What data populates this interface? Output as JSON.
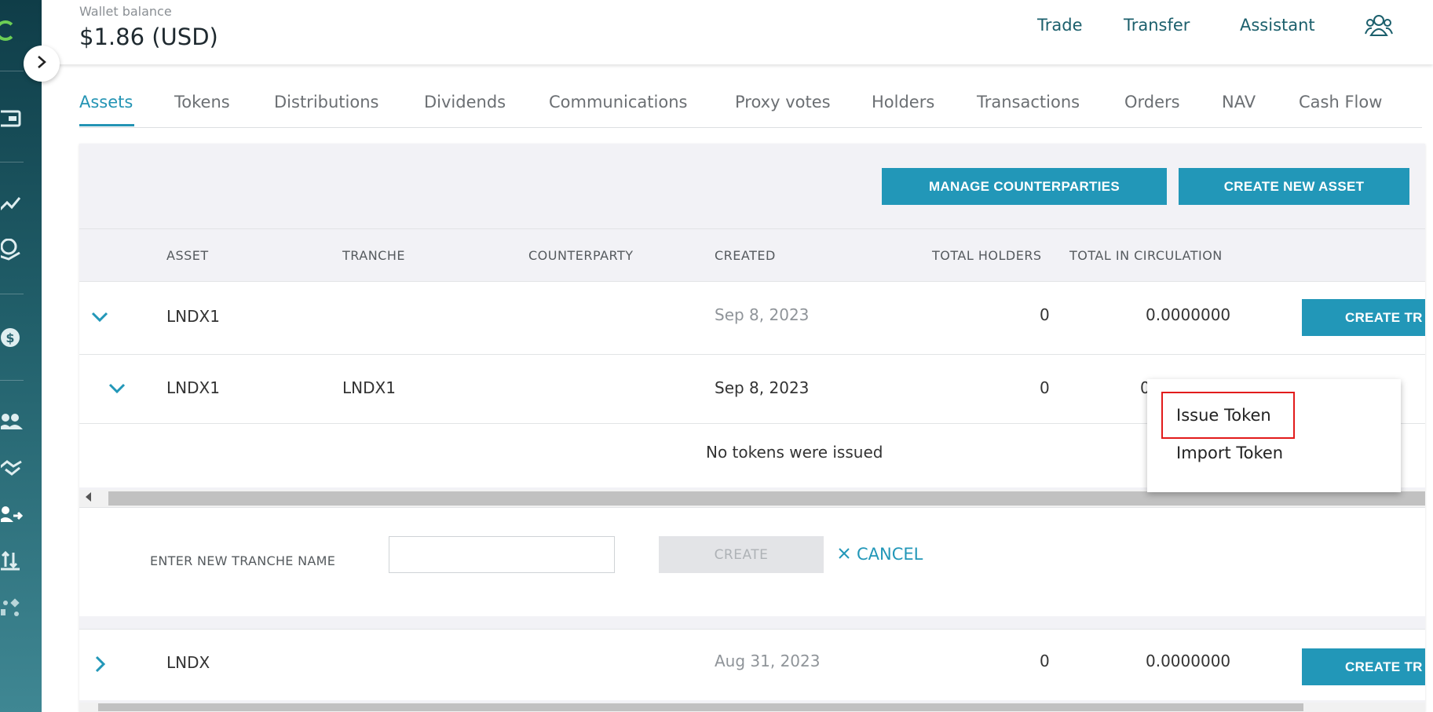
{
  "header": {
    "wallet_label": "Wallet balance",
    "wallet_value": "$1.86 (USD)",
    "nav": {
      "trade": "Trade",
      "transfer": "Transfer",
      "assistant": "Assistant"
    }
  },
  "tabs": [
    {
      "label": "Assets",
      "active": true
    },
    {
      "label": "Tokens"
    },
    {
      "label": "Distributions"
    },
    {
      "label": "Dividends"
    },
    {
      "label": "Communications"
    },
    {
      "label": "Proxy votes"
    },
    {
      "label": "Holders"
    },
    {
      "label": "Transactions"
    },
    {
      "label": "Orders"
    },
    {
      "label": "NAV"
    },
    {
      "label": "Cash Flow"
    }
  ],
  "toolbar": {
    "manage_counterparties": "MANAGE COUNTERPARTIES",
    "create_new_asset": "CREATE NEW ASSET"
  },
  "table": {
    "columns": [
      "ASSET",
      "TRANCHE",
      "COUNTERPARTY",
      "CREATED",
      "TOTAL HOLDERS",
      "TOTAL IN CIRCULATION"
    ],
    "rows": [
      {
        "asset": "LNDX1",
        "tranche": "",
        "counterparty": "",
        "created": "Sep 8, 2023",
        "holders": "0",
        "circulation": "0.0000000",
        "action": "CREATE TR"
      },
      {
        "asset": "LNDX1",
        "tranche": "LNDX1",
        "counterparty": "",
        "created": "Sep 8, 2023",
        "holders": "0",
        "circulation": "0"
      },
      {
        "asset": "LNDX",
        "tranche": "",
        "counterparty": "",
        "created": "Aug 31, 2023",
        "holders": "0",
        "circulation": "0.0000000",
        "action": "CREATE TR"
      }
    ],
    "empty_message": "No tokens were issued"
  },
  "menu": {
    "items": [
      "Issue Token",
      "Import Token"
    ],
    "highlighted": "Issue Token"
  },
  "tranche_form": {
    "label": "ENTER NEW TRANCHE NAME",
    "input_value": "",
    "create_label": "CREATE",
    "cancel_label": "CANCEL"
  },
  "colors": {
    "accent": "#2297b8",
    "nav_text": "#1b5f6c",
    "highlight": "#e21b1b",
    "sidebar_top": "#0f3d48",
    "sidebar_bottom": "#3f8793"
  },
  "icons": {
    "sidebar": [
      "logo-icon",
      "wallet-icon",
      "chart-icon",
      "money-hand-icon",
      "dollar-icon",
      "users-icon",
      "handshake-icon",
      "user-transfer-icon",
      "transfer-arrows-icon",
      "exchange-icon"
    ],
    "header": "people-icon"
  }
}
